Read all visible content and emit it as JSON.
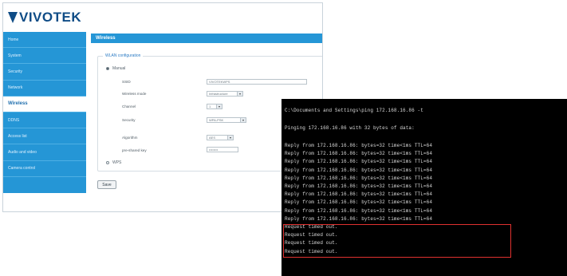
{
  "brand": {
    "logo_text": "VIVOTEK"
  },
  "sidebar": {
    "items": [
      {
        "label": "Home"
      },
      {
        "label": "System"
      },
      {
        "label": "Security"
      },
      {
        "label": "Network"
      },
      {
        "label": "Wireless",
        "active": true
      },
      {
        "label": "DDNS"
      },
      {
        "label": "Access list"
      },
      {
        "label": "Audio and video"
      },
      {
        "label": "Camera control"
      }
    ]
  },
  "content": {
    "header": "Wireless",
    "section_title": "WLAN configuration",
    "mode_manual": "Manual",
    "mode_wps": "WPS",
    "fields": [
      {
        "label": "SSID",
        "value": "VIVOTEKWPS",
        "type": "text"
      },
      {
        "label": "Wireless mode",
        "value": "Infrastructure",
        "type": "select"
      },
      {
        "label": "Channel",
        "value": "1",
        "type": "select"
      },
      {
        "label": "Security",
        "value": "WPA-PSK",
        "type": "select"
      },
      {
        "label": "Algorithm",
        "value": "AES",
        "type": "select"
      },
      {
        "label": "pre-shared key",
        "value": "••••••••",
        "type": "text"
      }
    ],
    "save_label": "Save"
  },
  "terminal": {
    "command": "C:\\Documents and Settings\\ping 172.168.16.86 -t",
    "pinging": "Pinging 172.168.16.86 with 32 bytes of data:",
    "replies": [
      "Reply from 172.168.16.86: bytes=32 time<1ms TTL=64",
      "Reply from 172.168.16.86: bytes=32 time<1ms TTL=64",
      "Reply from 172.168.16.86: bytes=32 time<1ms TTL=64",
      "Reply from 172.168.16.86: bytes=32 time<1ms TTL=64",
      "Reply from 172.168.16.86: bytes=32 time<1ms TTL=64",
      "Reply from 172.168.16.86: bytes=32 time<1ms TTL=64",
      "Reply from 172.168.16.86: bytes=32 time<1ms TTL=64",
      "Reply from 172.168.16.86: bytes=32 time<1ms TTL=64",
      "Reply from 172.168.16.86: bytes=32 time<1ms TTL=64",
      "Reply from 172.168.16.86: bytes=32 time<1ms TTL=64"
    ],
    "timeouts": [
      "Request timed out.",
      "Request timed out.",
      "Request timed out.",
      "Request timed out."
    ]
  },
  "colors": {
    "accent": "#2596d6",
    "highlight_box": "#e0312f",
    "terminal_bg": "#000000"
  }
}
